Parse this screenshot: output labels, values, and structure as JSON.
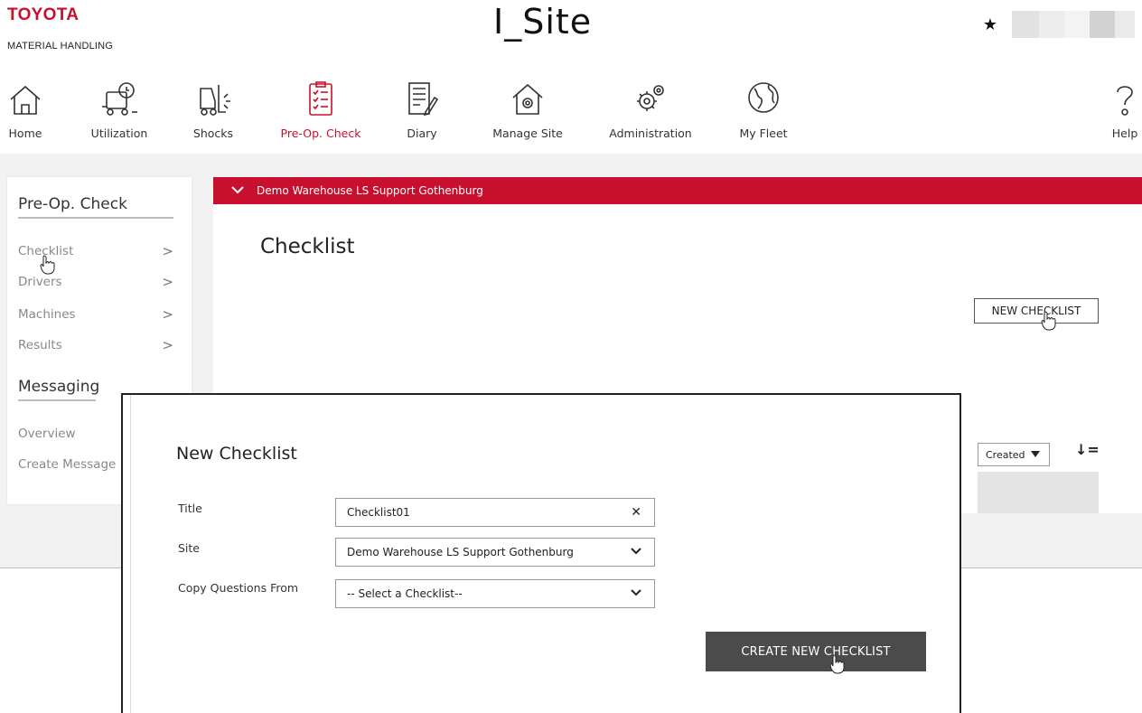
{
  "header": {
    "brand_name": "TOYOTA",
    "brand_sub": "MATERIAL HANDLING",
    "app_title": "I_Site",
    "star_glyph": "★"
  },
  "nav": {
    "items": [
      {
        "label": "Home",
        "icon": "home-icon"
      },
      {
        "label": "Utilization",
        "icon": "truck-clock-icon"
      },
      {
        "label": "Shocks",
        "icon": "forklift-shock-icon"
      },
      {
        "label": "Pre-Op. Check",
        "icon": "checklist-icon"
      },
      {
        "label": "Diary",
        "icon": "diary-icon"
      },
      {
        "label": "Manage Site",
        "icon": "house-gear-icon"
      },
      {
        "label": "Administration",
        "icon": "gears-icon"
      },
      {
        "label": "My Fleet",
        "icon": "globe-icon"
      },
      {
        "label": "Help",
        "icon": "help-icon"
      }
    ],
    "active_color": "#c8102e"
  },
  "sidebar": {
    "section1_title": "Pre-Op. Check",
    "section1_items": [
      "Checklist",
      "Drivers",
      "Machines",
      "Results"
    ],
    "section2_title": "Messaging",
    "section2_items": [
      "Overview",
      "Create Message"
    ],
    "chevron": ">"
  },
  "main": {
    "site_bar_label": "Demo Warehouse LS Support Gothenburg",
    "title": "Checklist",
    "new_button_label": "NEW CHECKLIST",
    "sort_selected": "Created",
    "sort_icon_glyph": "↓="
  },
  "modal": {
    "title": "New Checklist",
    "fields": [
      {
        "label": "Title",
        "value": "Checklist01",
        "control": "clear-x"
      },
      {
        "label": "Site",
        "value": "Demo Warehouse LS Support Gothenburg",
        "control": "chevron-down"
      },
      {
        "label": "Copy Questions From",
        "value": "-- Select a Checklist--",
        "control": "chevron-down"
      }
    ],
    "clear_glyph": "✕",
    "create_button_label": "CREATE NEW CHECKLIST"
  },
  "colors": {
    "brand_red": "#c8102e",
    "dark_button": "#4b4b4b",
    "page_gray": "#f2f2f2"
  }
}
